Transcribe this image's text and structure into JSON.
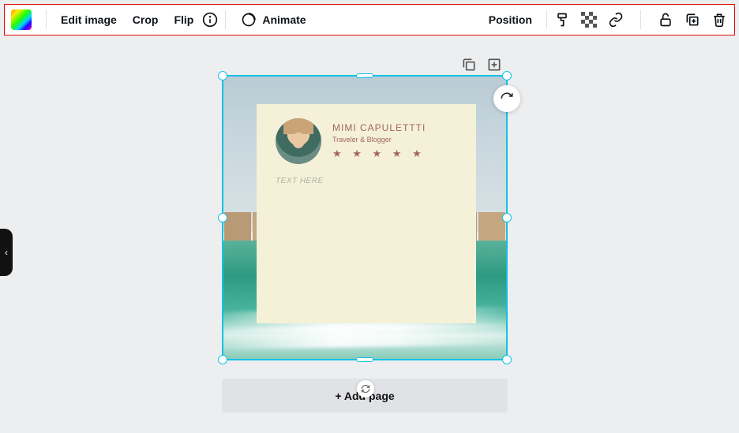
{
  "toolbar": {
    "edit_image": "Edit image",
    "crop": "Crop",
    "flip": "Flip",
    "animate": "Animate",
    "position": "Position"
  },
  "card": {
    "name": "MIMI CAPULETTTI",
    "subtitle": "Traveler & Blogger",
    "stars": "★ ★ ★ ★ ★",
    "placeholder": "TEXT HERE"
  },
  "add_page": "+ Add page",
  "side_tab_glyph": "‹"
}
